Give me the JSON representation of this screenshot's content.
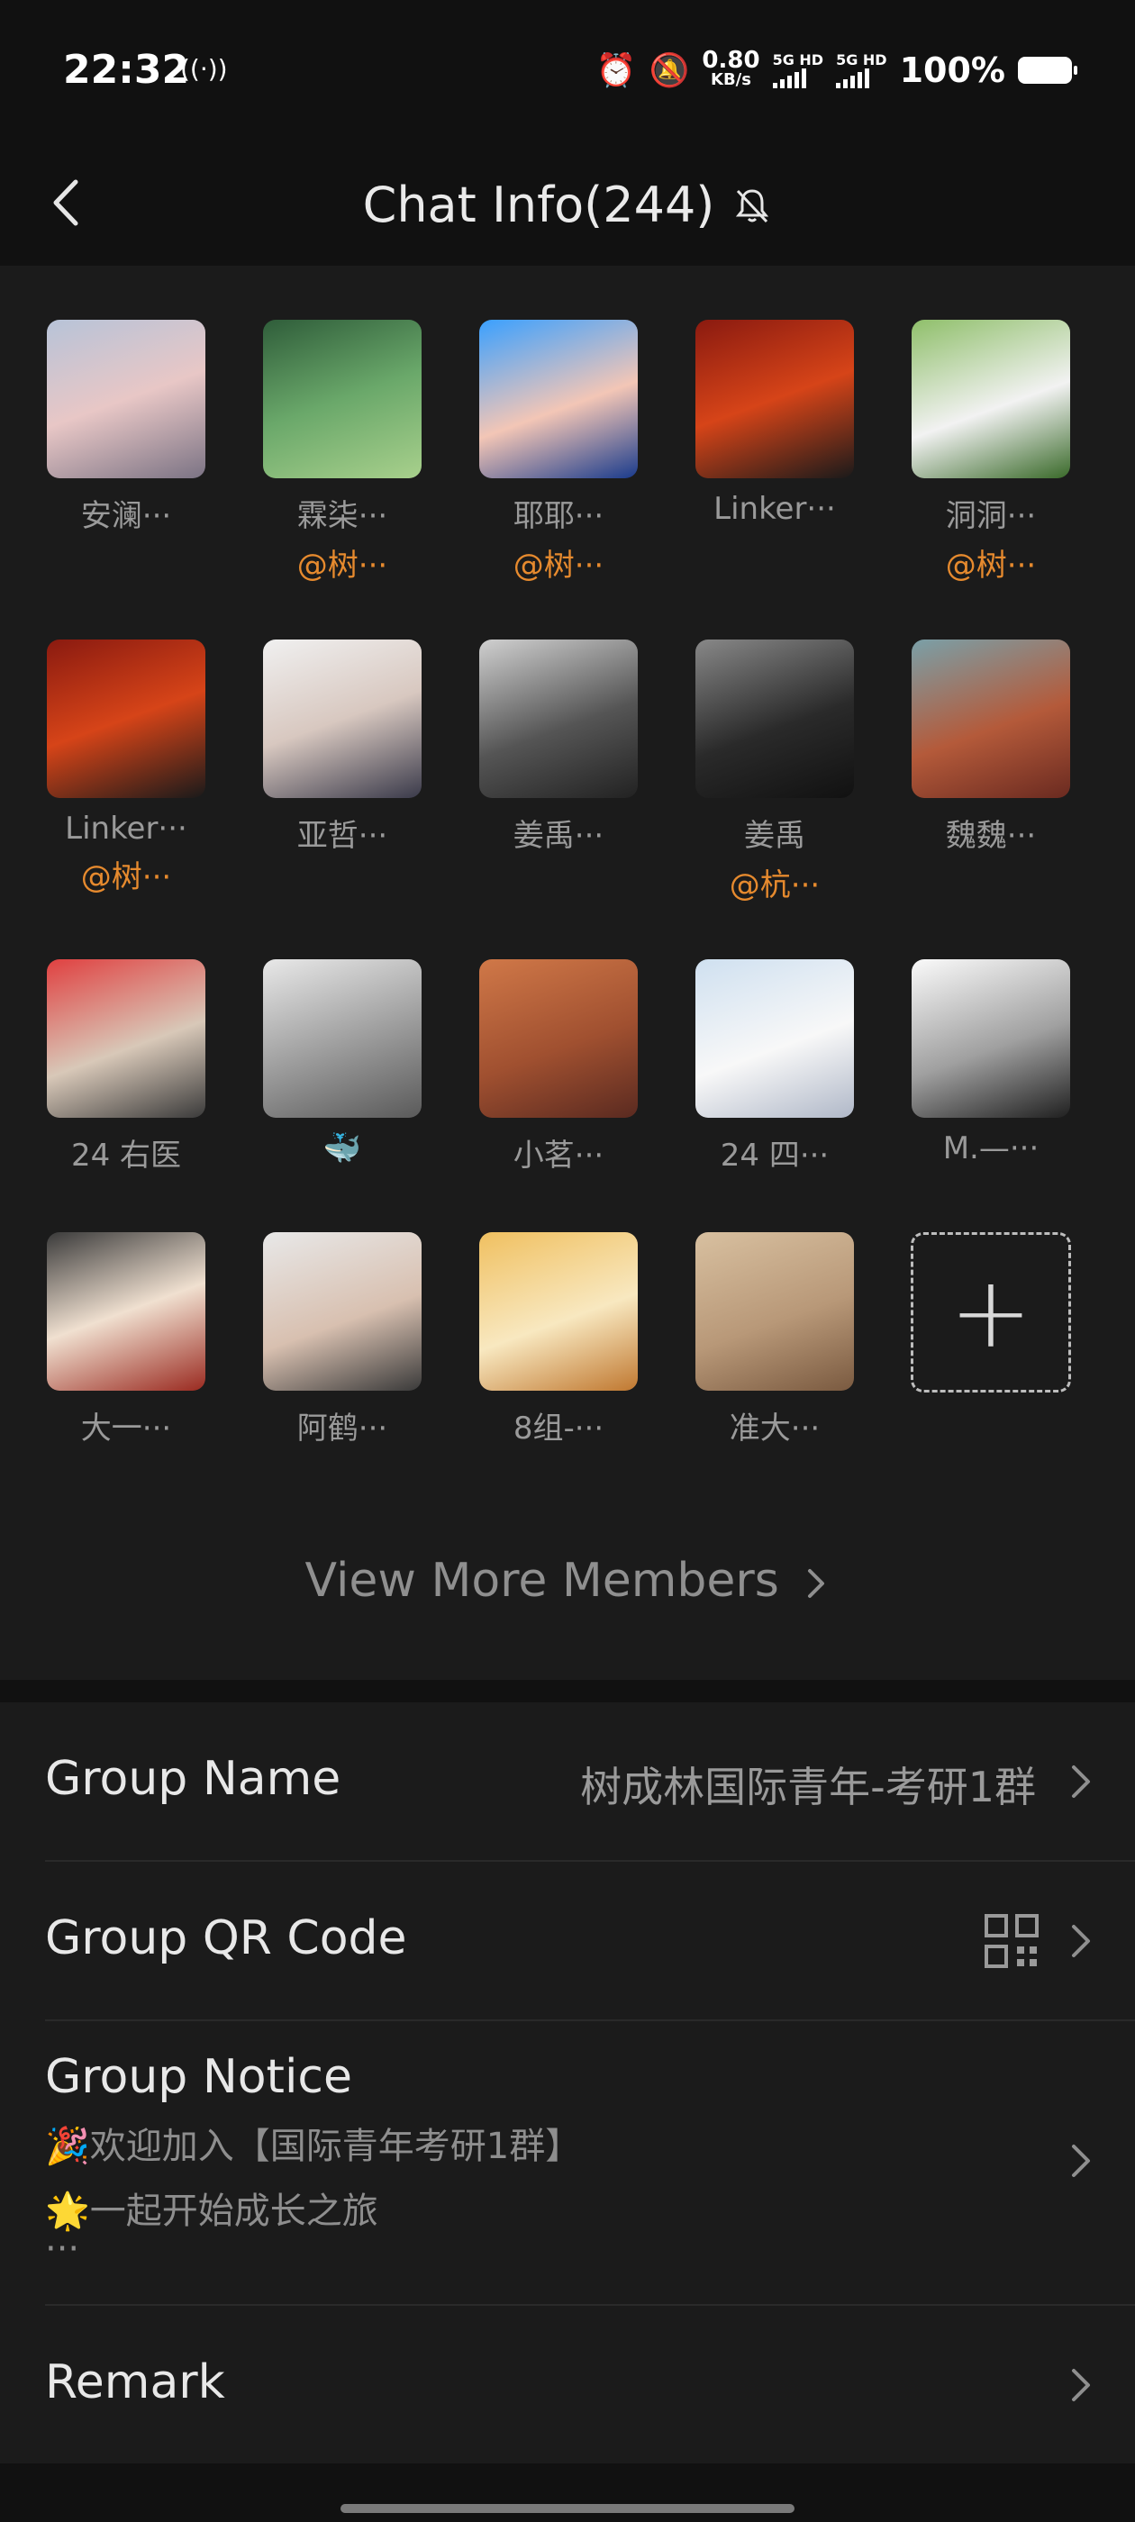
{
  "status_bar": {
    "time": "22:32",
    "net_speed_value": "0.80",
    "net_speed_unit": "KB/s",
    "sim1": "5G HD",
    "sim2": "5G HD",
    "battery": "100%"
  },
  "header": {
    "title": "Chat Info(244)"
  },
  "members": [
    {
      "name": "安澜···",
      "tag": ""
    },
    {
      "name": "霖柒···",
      "tag": "@树···"
    },
    {
      "name": "耶耶···",
      "tag": "@树···"
    },
    {
      "name": "Linker···",
      "tag": ""
    },
    {
      "name": "洞洞···",
      "tag": "@树···"
    },
    {
      "name": "Linker···",
      "tag": "@树···"
    },
    {
      "name": "亚哲···",
      "tag": ""
    },
    {
      "name": "姜禹···",
      "tag": ""
    },
    {
      "name": "姜禹",
      "tag": "@杭···"
    },
    {
      "name": "魏魏···",
      "tag": ""
    },
    {
      "name": "24 右医",
      "tag": ""
    },
    {
      "name": "🐳",
      "tag": ""
    },
    {
      "name": "小茗···",
      "tag": ""
    },
    {
      "name": "24 四···",
      "tag": ""
    },
    {
      "name": "M.—···",
      "tag": ""
    },
    {
      "name": "大一···",
      "tag": ""
    },
    {
      "name": "阿鹤···",
      "tag": ""
    },
    {
      "name": "8组-···",
      "tag": ""
    },
    {
      "name": "准大···",
      "tag": ""
    }
  ],
  "add_member_symbol": "+",
  "view_more": "View More Members",
  "settings": {
    "group_name_label": "Group Name",
    "group_name_value": "树成林国际青年-考研1群",
    "qr_label": "Group QR Code",
    "notice_label": "Group Notice",
    "notice_line1": "🎉欢迎加入【国际青年考研1群】",
    "notice_line2": "🌟一起开始成长之旅",
    "notice_more": "···",
    "remark_label": "Remark"
  }
}
